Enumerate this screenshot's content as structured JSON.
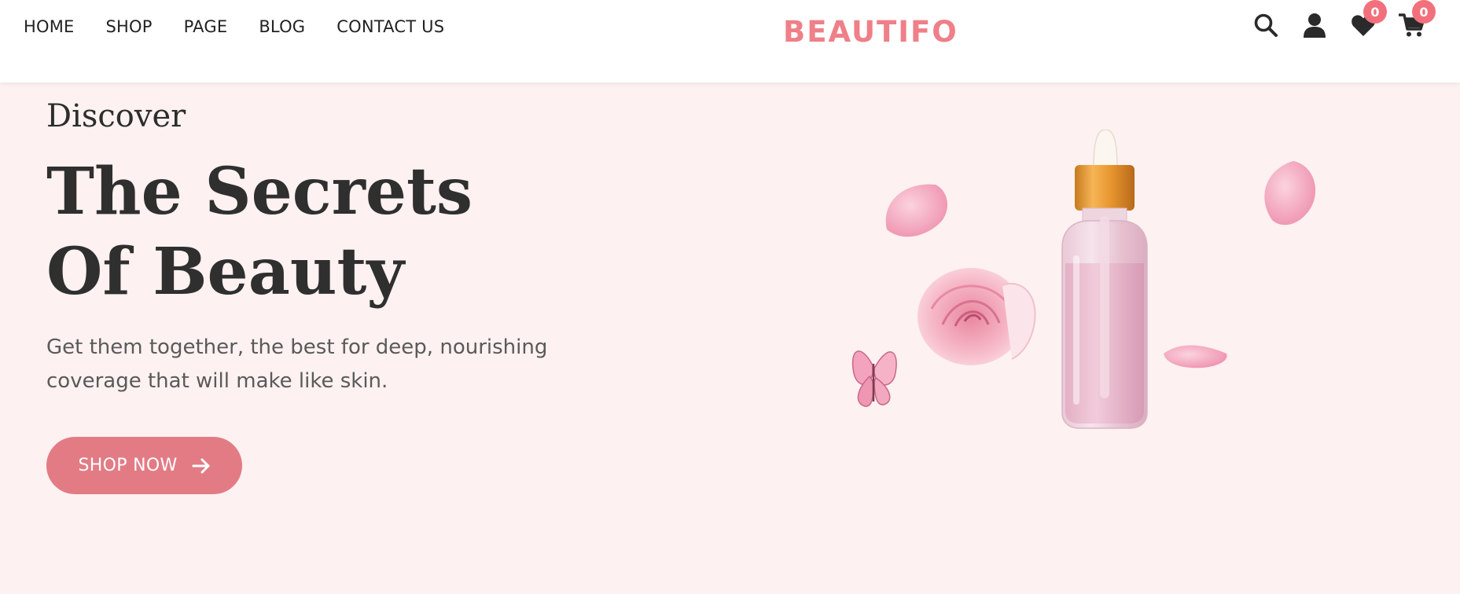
{
  "header": {
    "nav": [
      "HOME",
      "SHOP",
      "PAGE",
      "BLOG",
      "CONTACT US"
    ],
    "logo": "BEAUTIFO",
    "icons": {
      "search": "search-icon",
      "user": "user-icon",
      "wishlist": "heart-icon",
      "cart": "cart-icon"
    },
    "wishlist_count": "0",
    "cart_count": "0"
  },
  "hero": {
    "eyebrow": "Discover",
    "headline_line1": "The Secrets",
    "headline_line2": "Of Beauty",
    "subcopy_line1": "Get them together, the best for deep, nourishing",
    "subcopy_line2": "coverage that will make like skin.",
    "cta_label": "SHOP NOW",
    "cta_icon": "arrow-right-icon",
    "image": "serum-bottle-with-rose-and-petals"
  },
  "colors": {
    "accent": "#ef7f88",
    "button": "#e37b85",
    "badge": "#f2707c",
    "hero_bg": "#fdf1f1",
    "text_dark": "#2f2f2f"
  }
}
